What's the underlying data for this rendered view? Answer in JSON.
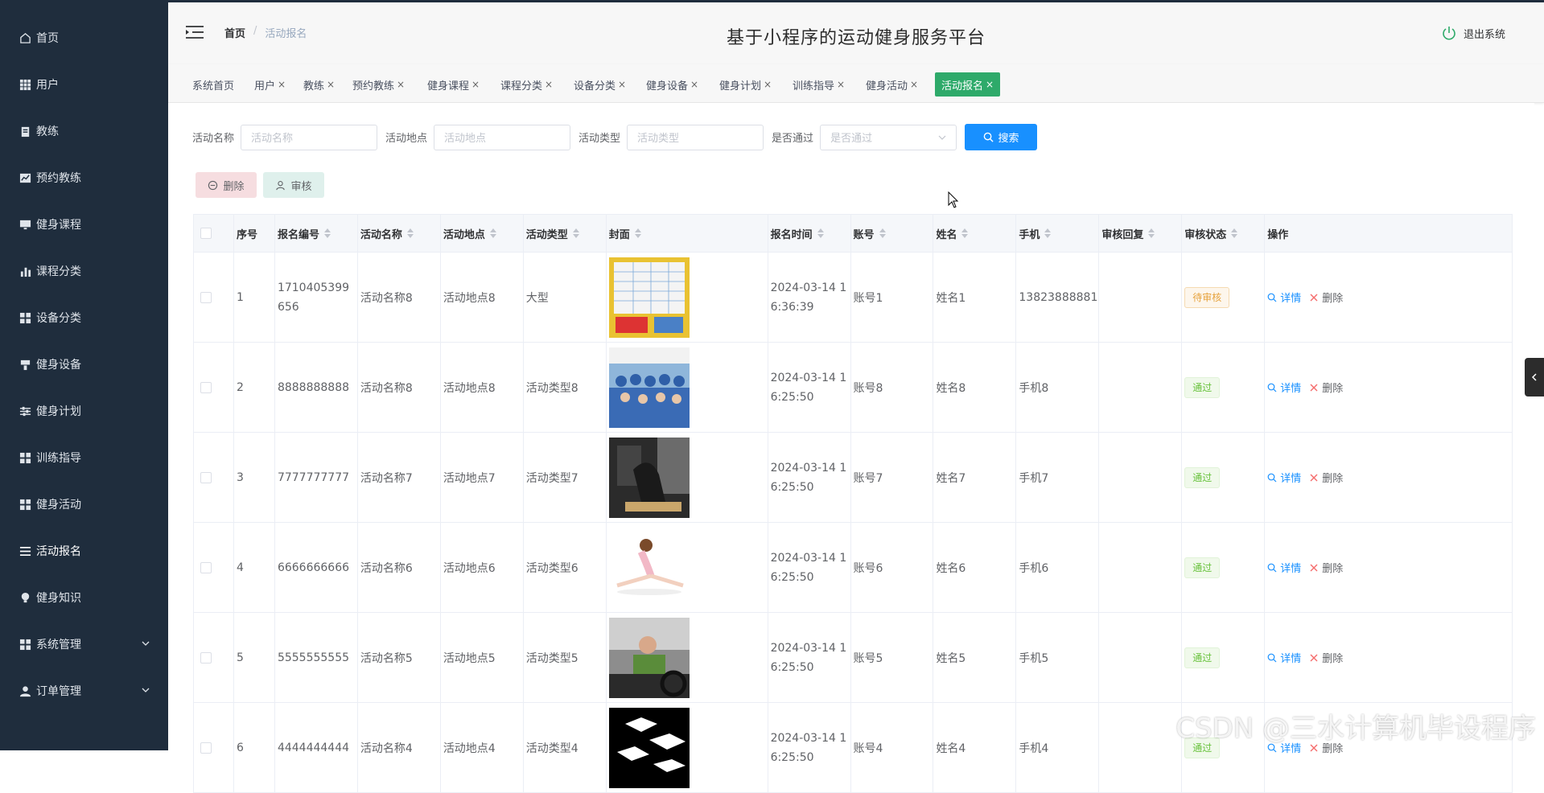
{
  "sidebar": {
    "items": [
      {
        "label": "首页",
        "icon": "home-icon"
      },
      {
        "label": "用户",
        "icon": "grid-icon"
      },
      {
        "label": "教练",
        "icon": "clipboard-icon"
      },
      {
        "label": "预约教练",
        "icon": "chart-icon"
      },
      {
        "label": "健身课程",
        "icon": "monitor-icon"
      },
      {
        "label": "课程分类",
        "icon": "bar-chart-icon"
      },
      {
        "label": "设备分类",
        "icon": "apps-icon"
      },
      {
        "label": "健身设备",
        "icon": "brush-icon"
      },
      {
        "label": "健身计划",
        "icon": "sliders-icon"
      },
      {
        "label": "训练指导",
        "icon": "apps-icon"
      },
      {
        "label": "健身活动",
        "icon": "apps-icon"
      },
      {
        "label": "活动报名",
        "icon": "list-icon"
      },
      {
        "label": "健身知识",
        "icon": "bulb-icon"
      },
      {
        "label": "系统管理",
        "icon": "apps-icon"
      },
      {
        "label": "订单管理",
        "icon": "user-icon"
      }
    ]
  },
  "header": {
    "breadcrumb_home": "首页",
    "breadcrumb_sep": "/",
    "breadcrumb_current": "活动报名",
    "title": "基于小程序的运动健身服务平台",
    "logout": "退出系统"
  },
  "tags": [
    {
      "label": "系统首页",
      "closable": false
    },
    {
      "label": "用户",
      "closable": true
    },
    {
      "label": "教练",
      "closable": true
    },
    {
      "label": "预约教练",
      "closable": true
    },
    {
      "label": "健身课程",
      "closable": true
    },
    {
      "label": "课程分类",
      "closable": true
    },
    {
      "label": "设备分类",
      "closable": true
    },
    {
      "label": "健身设备",
      "closable": true
    },
    {
      "label": "健身计划",
      "closable": true
    },
    {
      "label": "训练指导",
      "closable": true
    },
    {
      "label": "健身活动",
      "closable": true
    },
    {
      "label": "活动报名",
      "closable": true,
      "active": true
    }
  ],
  "tag_close": "×",
  "search": {
    "name_label": "活动名称",
    "name_placeholder": "活动名称",
    "addr_label": "活动地点",
    "addr_placeholder": "活动地点",
    "type_label": "活动类型",
    "type_placeholder": "活动类型",
    "pass_label": "是否通过",
    "pass_placeholder": "是否通过",
    "search_button": "搜索"
  },
  "actions": {
    "delete": "删除",
    "audit": "审核"
  },
  "table": {
    "headers": [
      "序号",
      "报名编号",
      "活动名称",
      "活动地点",
      "活动类型",
      "封面",
      "报名时间",
      "账号",
      "姓名",
      "手机",
      "审核回复",
      "审核状态",
      "操作"
    ],
    "rows": [
      {
        "idx": "1",
        "no": "1710405399656",
        "name": "活动名称8",
        "addr": "活动地点8",
        "type": "大型",
        "time": "2024-03-14 16:36:39",
        "acct": "账号1",
        "uname": "姓名1",
        "phone": "13823888881",
        "reply": "",
        "status": "待审核",
        "status_kind": "pending"
      },
      {
        "idx": "2",
        "no": "8888888888",
        "name": "活动名称8",
        "addr": "活动地点8",
        "type": "活动类型8",
        "time": "2024-03-14 16:25:50",
        "acct": "账号8",
        "uname": "姓名8",
        "phone": "手机8",
        "reply": "",
        "status": "通过",
        "status_kind": "pass"
      },
      {
        "idx": "3",
        "no": "7777777777",
        "name": "活动名称7",
        "addr": "活动地点7",
        "type": "活动类型7",
        "time": "2024-03-14 16:25:50",
        "acct": "账号7",
        "uname": "姓名7",
        "phone": "手机7",
        "reply": "",
        "status": "通过",
        "status_kind": "pass"
      },
      {
        "idx": "4",
        "no": "6666666666",
        "name": "活动名称6",
        "addr": "活动地点6",
        "type": "活动类型6",
        "time": "2024-03-14 16:25:50",
        "acct": "账号6",
        "uname": "姓名6",
        "phone": "手机6",
        "reply": "",
        "status": "通过",
        "status_kind": "pass"
      },
      {
        "idx": "5",
        "no": "5555555555",
        "name": "活动名称5",
        "addr": "活动地点5",
        "type": "活动类型5",
        "time": "2024-03-14 16:25:50",
        "acct": "账号5",
        "uname": "姓名5",
        "phone": "手机5",
        "reply": "",
        "status": "通过",
        "status_kind": "pass"
      },
      {
        "idx": "6",
        "no": "4444444444",
        "name": "活动名称4",
        "addr": "活动地点4",
        "type": "活动类型4",
        "time": "2024-03-14 16:25:50",
        "acct": "账号4",
        "uname": "姓名4",
        "phone": "手机4",
        "reply": "",
        "status": "通过",
        "status_kind": "pass"
      }
    ],
    "op_detail": "详情",
    "op_delete": "删除"
  },
  "watermark": "CSDN @三水计算机毕设程序",
  "colors": {
    "sidebar_bg": "#1f2d3d",
    "active_tag": "#2eaa6a",
    "search_btn": "#1890ff"
  }
}
